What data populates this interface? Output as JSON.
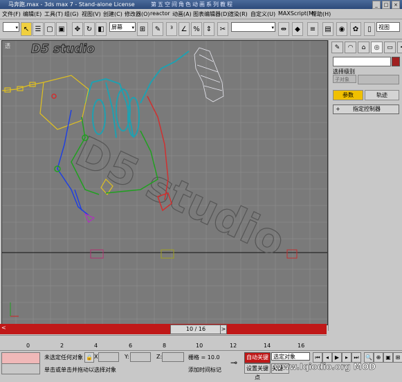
{
  "titlebar": {
    "title": "马奔跑.max - 3ds max 7 - Stand-alone License",
    "watermark": "第五空间角色动画系列教程",
    "min": "_",
    "max": "□",
    "close": "×"
  },
  "menu": [
    "文件(F)",
    "编辑(E)",
    "工具(T)",
    "组(G)",
    "视图(V)",
    "创建(C)",
    "修改器(O)",
    "reactor",
    "动画(A)",
    "图表编辑器(D)",
    "渲染(R)",
    "自定义(U)",
    "MAXScript(M)",
    "帮助(H)"
  ],
  "toolbar": {
    "undo_dropdown": "",
    "ref_coord": "屏幕",
    "named_sel": "",
    "view_label": "视图"
  },
  "viewport": {
    "label": "透",
    "logo": "D5 studio",
    "watermark_text": "D5 studio"
  },
  "command_panel": {
    "selection_level_label": "选择级别",
    "sublevel": "子对象",
    "tab_params": "参数",
    "tab_tracks": "轨迹",
    "rollout_sign": "+",
    "rollout_label": "指定控制器"
  },
  "time_slider": {
    "position_label": "10 / 16",
    "left_arrow": "<",
    "right_arrow": ">"
  },
  "trackbar": {
    "ticks": [
      "0",
      "2",
      "4",
      "6",
      "8",
      "10",
      "12",
      "14",
      "16"
    ]
  },
  "statusbar": {
    "none_selected": "未选定任何对象",
    "prompt": "单击或单击并拖动以选择对象",
    "x_label": "X:",
    "y_label": "Y:",
    "z_label": "Z:",
    "grid_label": "栅格 = 10.0",
    "add_time_tag": "添加时间标记",
    "auto_key": "自动关键点",
    "set_key": "设置关键点",
    "selected_object": "选定对象",
    "key_filter": "关键",
    "site_watermark": "www.Iqiodio.org MOD"
  }
}
